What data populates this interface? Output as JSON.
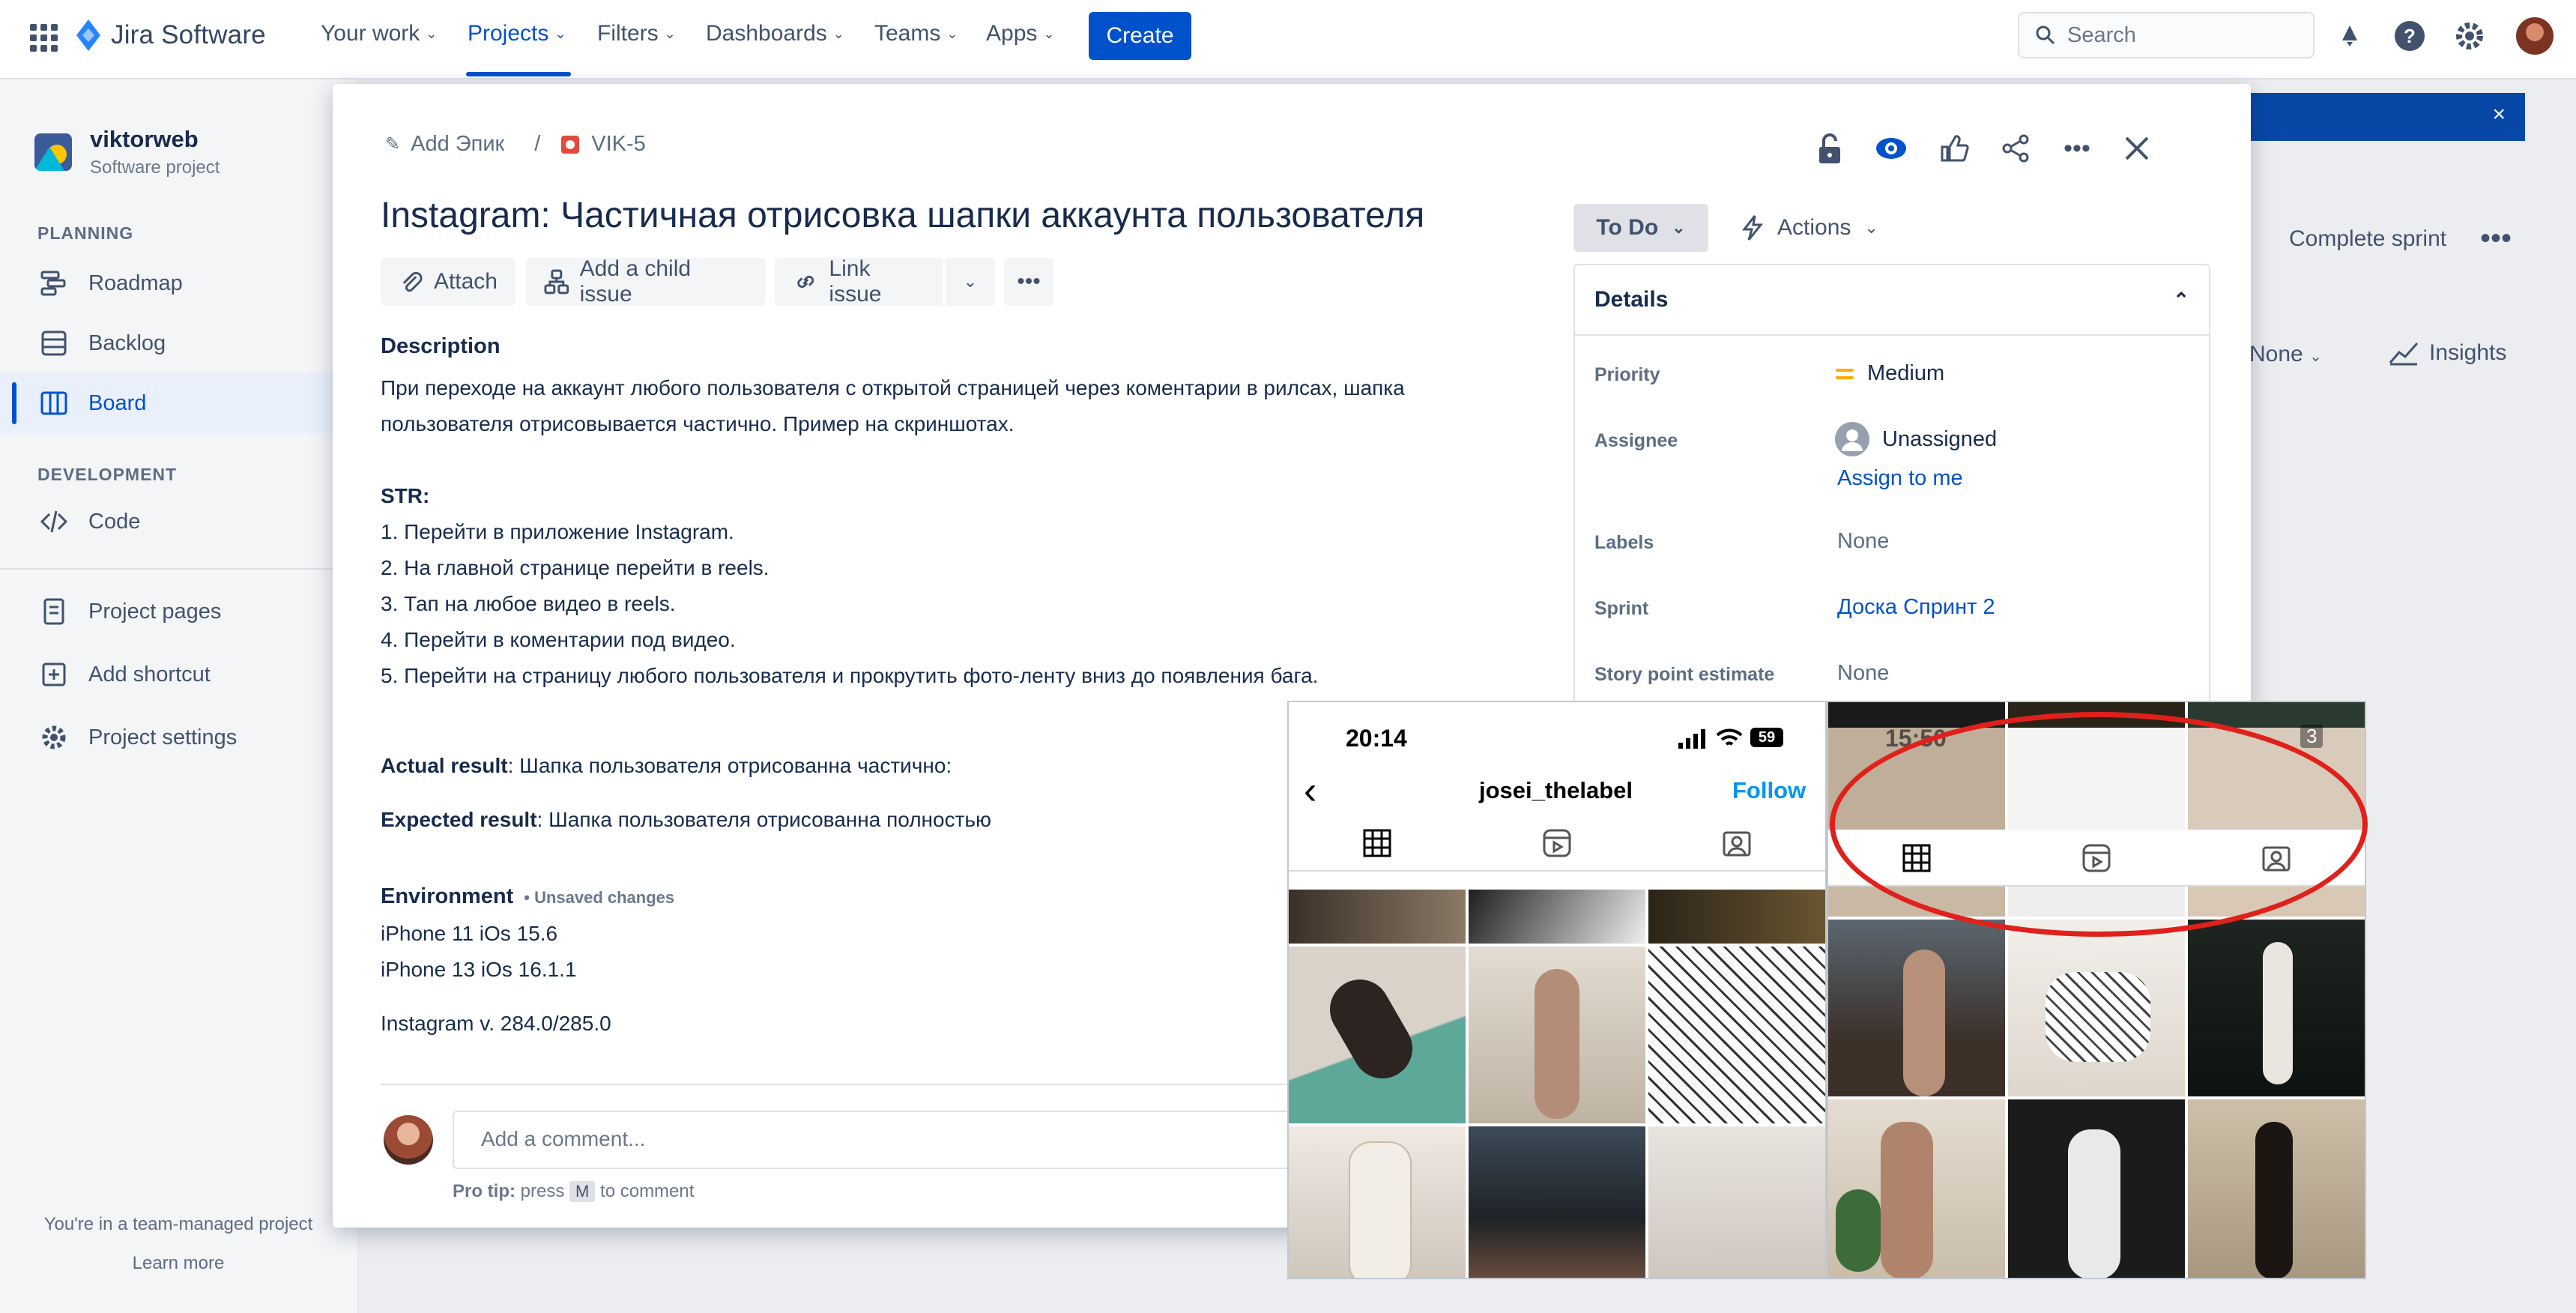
{
  "topnav": {
    "logo": "Jira Software",
    "items": [
      {
        "label": "Your work"
      },
      {
        "label": "Projects"
      },
      {
        "label": "Filters"
      },
      {
        "label": "Dashboards"
      },
      {
        "label": "Teams"
      },
      {
        "label": "Apps"
      }
    ],
    "create": "Create",
    "search_placeholder": "Search"
  },
  "sidebar": {
    "project_name": "viktorweb",
    "project_type": "Software project",
    "planning_heading": "PLANNING",
    "planning": [
      {
        "label": "Roadmap"
      },
      {
        "label": "Backlog"
      },
      {
        "label": "Board"
      }
    ],
    "development_heading": "DEVELOPMENT",
    "development": [
      {
        "label": "Code"
      }
    ],
    "other": [
      {
        "label": "Project pages"
      },
      {
        "label": "Add shortcut"
      },
      {
        "label": "Project settings"
      }
    ],
    "footer_text": "You're in a team-managed project",
    "footer_link": "Learn more"
  },
  "board_background": {
    "complete_sprint": "Complete sprint",
    "group_none": "None",
    "insights": "Insights"
  },
  "issue": {
    "breadcrumb_epic": "Add Эпик",
    "breadcrumb_sep": "/",
    "key": "VIK-5",
    "title": "Instagram: Частичная отрисовка шапки аккаунта пользователя",
    "toolbar": {
      "attach": "Attach",
      "child": "Add a child issue",
      "link": "Link issue"
    },
    "description_label": "Description",
    "description": [
      "При переходе на аккаунт любого пользователя с открытой страницей через коментарии в рилсах, шапка",
      "пользователя отрисовывается частично. Пример на скриншотах."
    ],
    "str_label": "STR:",
    "steps": [
      "1. Перейти в приложение Instagram.",
      "2. На главной странице перейти в reels.",
      "3. Тап на любое видео в reels.",
      "4. Перейти в коментарии под видео.",
      "5. Перейти на страницу любого пользователя и прокрутить фото-ленту вниз до появления бага."
    ],
    "actual_label": "Actual result",
    "actual_text": ": Шапка пользователя отрисованна частично:",
    "expected_label": "Expected result",
    "expected_text": ": Шапка пользователя отрисованна полностью",
    "environment_label": "Environment",
    "unsaved": "• Unsaved changes",
    "environment": [
      "iPhone 11 iOs 15.6",
      "iPhone 13 iOs 16.1.1"
    ],
    "app_version": "Instagram v. 284.0/285.0",
    "comment_placeholder": "Add a comment...",
    "protip_label": "Pro tip:",
    "protip_press": "press",
    "protip_key": "M",
    "protip_rest": "to comment"
  },
  "status": {
    "current": "To Do",
    "actions": "Actions"
  },
  "details": {
    "heading": "Details",
    "fields": {
      "priority_label": "Priority",
      "priority_value": "Medium",
      "assignee_label": "Assignee",
      "assignee_value": "Unassigned",
      "assign_me": "Assign to me",
      "labels_label": "Labels",
      "labels_value": "None",
      "sprint_label": "Sprint",
      "sprint_value": "Доска Спринт 2",
      "story_label": "Story point estimate",
      "story_value": "None"
    }
  },
  "screenshots": {
    "time": "20:14",
    "battery": "59",
    "time2": "15:50",
    "badge": "3",
    "username": "josei_thelabel",
    "follow": "Follow"
  },
  "colors": {
    "accent": "#0052cc",
    "highlight": "#e0201b",
    "priority": "#ffab00"
  }
}
